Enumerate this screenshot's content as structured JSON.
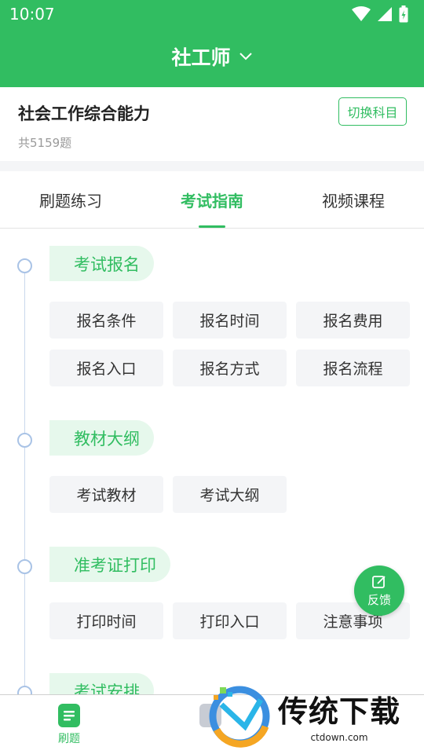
{
  "status_bar": {
    "time": "10:07"
  },
  "header": {
    "title": "社工师"
  },
  "subject": {
    "name": "社会工作综合能力",
    "count": "共5159题",
    "switch_label": "切换科目"
  },
  "tabs": [
    {
      "label": "刷题练习",
      "active": false
    },
    {
      "label": "考试指南",
      "active": true
    },
    {
      "label": "视频课程",
      "active": false
    }
  ],
  "sections": [
    {
      "title": "考试报名",
      "items": [
        "报名条件",
        "报名时间",
        "报名费用",
        "报名入口",
        "报名方式",
        "报名流程"
      ]
    },
    {
      "title": "教材大纲",
      "items": [
        "考试教材",
        "考试大纲"
      ]
    },
    {
      "title": "准考证打印",
      "items": [
        "打印时间",
        "打印入口",
        "注意事项"
      ]
    },
    {
      "title": "考试安排",
      "items": []
    }
  ],
  "feedback": {
    "label": "反馈"
  },
  "bottom_nav": {
    "items": [
      {
        "label": "刷题",
        "active": true
      }
    ]
  },
  "watermark": {
    "title": "传统下载",
    "url": "ctdown.com"
  },
  "colors": {
    "accent": "#31bd61",
    "accent_light": "#e6f8ec",
    "chip_bg": "#f4f5f7",
    "timeline": "#a9c3e6"
  }
}
